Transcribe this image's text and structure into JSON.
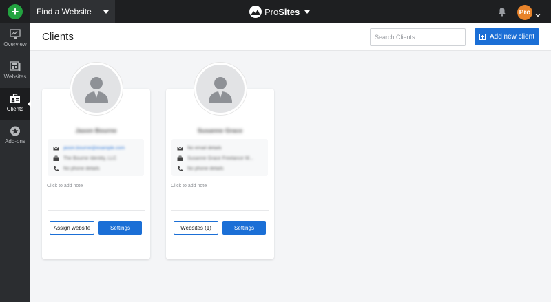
{
  "topbar": {
    "site_select_label": "Find a Website",
    "brand_part_a": "Pro",
    "brand_part_b": "Sites",
    "account_badge": "Pro"
  },
  "sidebar": {
    "items": [
      {
        "label": "Overview",
        "icon": "monitor-icon"
      },
      {
        "label": "Websites",
        "icon": "websites-icon"
      },
      {
        "label": "Clients",
        "icon": "clients-icon",
        "active": true
      },
      {
        "label": "Add-ons",
        "icon": "star-icon"
      }
    ]
  },
  "header": {
    "title": "Clients",
    "search_placeholder": "Search Clients",
    "add_button_label": "Add new client"
  },
  "clients": [
    {
      "name": "Jason Bourne",
      "email": "jason.bourne@example.com",
      "company": "The Bourne Identity, LLC",
      "phone": "No phone details",
      "note": "Click to add note",
      "primary_action": "Assign website",
      "settings_label": "Settings"
    },
    {
      "name": "Susanne Grace",
      "email": "No email details",
      "company": "Susanne Grace Freelance W...",
      "phone": "No phone details",
      "note": "Click to add note",
      "primary_action": "Websites (1)",
      "settings_label": "Settings"
    }
  ],
  "colors": {
    "accent": "#1b6fd6",
    "topbar": "#1e1f21",
    "sidebar": "#2b2d30",
    "create": "#23a340",
    "pro_badge": "#e8832a"
  }
}
